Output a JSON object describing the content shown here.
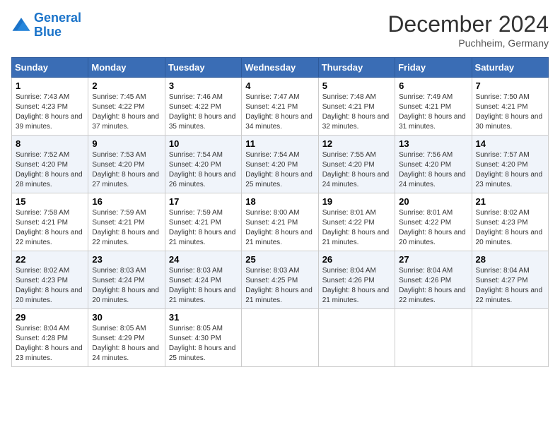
{
  "header": {
    "logo_line1": "General",
    "logo_line2": "Blue",
    "month": "December 2024",
    "location": "Puchheim, Germany"
  },
  "days_of_week": [
    "Sunday",
    "Monday",
    "Tuesday",
    "Wednesday",
    "Thursday",
    "Friday",
    "Saturday"
  ],
  "weeks": [
    [
      {
        "day": "1",
        "sunrise": "7:43 AM",
        "sunset": "4:23 PM",
        "daylight": "8 hours and 39 minutes."
      },
      {
        "day": "2",
        "sunrise": "7:45 AM",
        "sunset": "4:22 PM",
        "daylight": "8 hours and 37 minutes."
      },
      {
        "day": "3",
        "sunrise": "7:46 AM",
        "sunset": "4:22 PM",
        "daylight": "8 hours and 35 minutes."
      },
      {
        "day": "4",
        "sunrise": "7:47 AM",
        "sunset": "4:21 PM",
        "daylight": "8 hours and 34 minutes."
      },
      {
        "day": "5",
        "sunrise": "7:48 AM",
        "sunset": "4:21 PM",
        "daylight": "8 hours and 32 minutes."
      },
      {
        "day": "6",
        "sunrise": "7:49 AM",
        "sunset": "4:21 PM",
        "daylight": "8 hours and 31 minutes."
      },
      {
        "day": "7",
        "sunrise": "7:50 AM",
        "sunset": "4:21 PM",
        "daylight": "8 hours and 30 minutes."
      }
    ],
    [
      {
        "day": "8",
        "sunrise": "7:52 AM",
        "sunset": "4:20 PM",
        "daylight": "8 hours and 28 minutes."
      },
      {
        "day": "9",
        "sunrise": "7:53 AM",
        "sunset": "4:20 PM",
        "daylight": "8 hours and 27 minutes."
      },
      {
        "day": "10",
        "sunrise": "7:54 AM",
        "sunset": "4:20 PM",
        "daylight": "8 hours and 26 minutes."
      },
      {
        "day": "11",
        "sunrise": "7:54 AM",
        "sunset": "4:20 PM",
        "daylight": "8 hours and 25 minutes."
      },
      {
        "day": "12",
        "sunrise": "7:55 AM",
        "sunset": "4:20 PM",
        "daylight": "8 hours and 24 minutes."
      },
      {
        "day": "13",
        "sunrise": "7:56 AM",
        "sunset": "4:20 PM",
        "daylight": "8 hours and 24 minutes."
      },
      {
        "day": "14",
        "sunrise": "7:57 AM",
        "sunset": "4:20 PM",
        "daylight": "8 hours and 23 minutes."
      }
    ],
    [
      {
        "day": "15",
        "sunrise": "7:58 AM",
        "sunset": "4:21 PM",
        "daylight": "8 hours and 22 minutes."
      },
      {
        "day": "16",
        "sunrise": "7:59 AM",
        "sunset": "4:21 PM",
        "daylight": "8 hours and 22 minutes."
      },
      {
        "day": "17",
        "sunrise": "7:59 AM",
        "sunset": "4:21 PM",
        "daylight": "8 hours and 21 minutes."
      },
      {
        "day": "18",
        "sunrise": "8:00 AM",
        "sunset": "4:21 PM",
        "daylight": "8 hours and 21 minutes."
      },
      {
        "day": "19",
        "sunrise": "8:01 AM",
        "sunset": "4:22 PM",
        "daylight": "8 hours and 21 minutes."
      },
      {
        "day": "20",
        "sunrise": "8:01 AM",
        "sunset": "4:22 PM",
        "daylight": "8 hours and 20 minutes."
      },
      {
        "day": "21",
        "sunrise": "8:02 AM",
        "sunset": "4:23 PM",
        "daylight": "8 hours and 20 minutes."
      }
    ],
    [
      {
        "day": "22",
        "sunrise": "8:02 AM",
        "sunset": "4:23 PM",
        "daylight": "8 hours and 20 minutes."
      },
      {
        "day": "23",
        "sunrise": "8:03 AM",
        "sunset": "4:24 PM",
        "daylight": "8 hours and 20 minutes."
      },
      {
        "day": "24",
        "sunrise": "8:03 AM",
        "sunset": "4:24 PM",
        "daylight": "8 hours and 21 minutes."
      },
      {
        "day": "25",
        "sunrise": "8:03 AM",
        "sunset": "4:25 PM",
        "daylight": "8 hours and 21 minutes."
      },
      {
        "day": "26",
        "sunrise": "8:04 AM",
        "sunset": "4:26 PM",
        "daylight": "8 hours and 21 minutes."
      },
      {
        "day": "27",
        "sunrise": "8:04 AM",
        "sunset": "4:26 PM",
        "daylight": "8 hours and 22 minutes."
      },
      {
        "day": "28",
        "sunrise": "8:04 AM",
        "sunset": "4:27 PM",
        "daylight": "8 hours and 22 minutes."
      }
    ],
    [
      {
        "day": "29",
        "sunrise": "8:04 AM",
        "sunset": "4:28 PM",
        "daylight": "8 hours and 23 minutes."
      },
      {
        "day": "30",
        "sunrise": "8:05 AM",
        "sunset": "4:29 PM",
        "daylight": "8 hours and 24 minutes."
      },
      {
        "day": "31",
        "sunrise": "8:05 AM",
        "sunset": "4:30 PM",
        "daylight": "8 hours and 25 minutes."
      },
      null,
      null,
      null,
      null
    ]
  ]
}
